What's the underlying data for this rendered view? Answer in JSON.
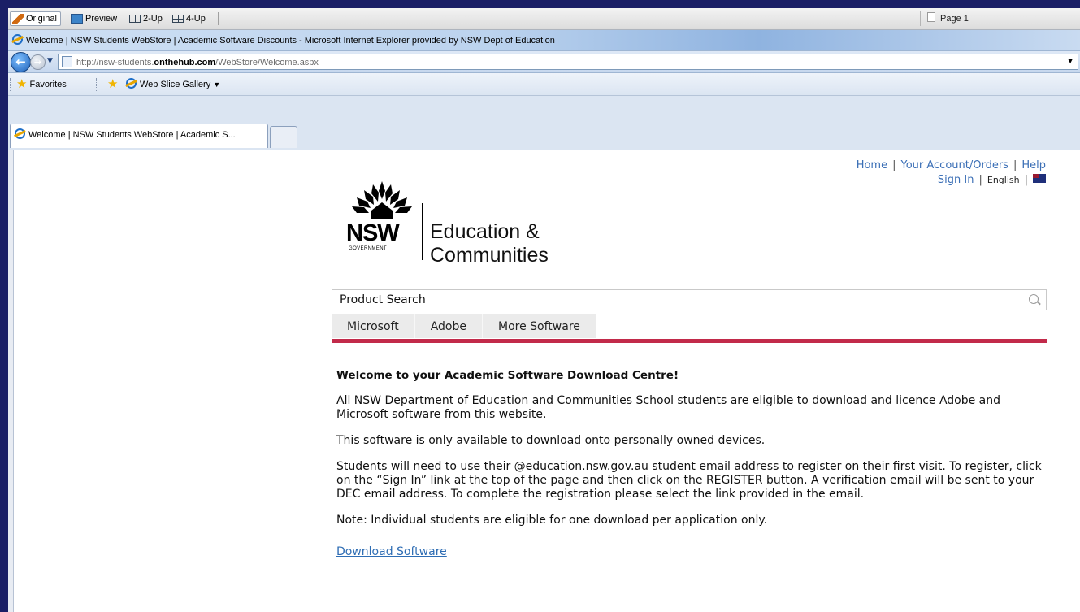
{
  "viewer": {
    "original_label": "Original",
    "preview_label": "Preview",
    "twoup_label": "2-Up",
    "fourup_label": "4-Up",
    "page_indicator": "Page 1"
  },
  "browser": {
    "window_title": "Welcome | NSW Students WebStore | Academic Software Discounts - Microsoft Internet Explorer provided by NSW Dept of Education",
    "url_prefix": "http://nsw-students.",
    "url_domain": "onthehub.com",
    "url_path": "/WebStore/Welcome.aspx",
    "favorites_label": "Favorites",
    "web_slice_label": "Web Slice Gallery",
    "tab_title": "Welcome | NSW Students WebStore | Academic S..."
  },
  "page": {
    "top_links": {
      "home": "Home",
      "account": "Your Account/Orders",
      "help": "Help",
      "sign_in": "Sign In",
      "language": "English",
      "separator": "|"
    },
    "logo": {
      "nsw": "NSW",
      "government": "GOVERNMENT",
      "line1": "Education",
      "amp": "&",
      "line2": "Communities"
    },
    "search": {
      "value": "Product Search"
    },
    "nav_tabs": [
      "Microsoft",
      "Adobe",
      "More Software"
    ],
    "heading": "Welcome to your Academic Software Download Centre!",
    "paragraphs": [
      "All NSW Department of Education and Communities School students are eligible to download and licence Adobe and Microsoft software from this website.",
      "This software is only available to download onto personally owned devices.",
      "Students will need to use their @education.nsw.gov.au student email address to register on their first visit. To register, click on the “Sign In” link at the top of the page and then click on the REGISTER button. A verification email will be sent to your DEC email address. To complete the registration please select the link provided in the email.",
      "Note: Individual students are eligible for one download per application only."
    ],
    "download_link": "Download Software"
  },
  "colors": {
    "accent_rule": "#c22a4a",
    "link": "#3b6fb6"
  }
}
